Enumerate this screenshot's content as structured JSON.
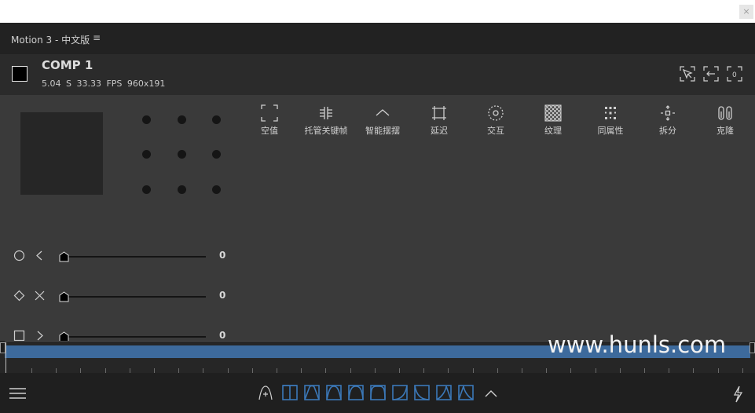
{
  "window": {
    "close_glyph": "×"
  },
  "titlebar": {
    "title": "Motion 3 - 中文版",
    "menu_icon": "≡"
  },
  "comp": {
    "name": "COMP 1",
    "duration": "5.04 S",
    "fps": "33.33 FPS",
    "size": "960x191",
    "swatch_color": "#000000"
  },
  "header_buttons": [
    "select-cursor-icon",
    "fit-left-icon",
    "fit-zero-icon"
  ],
  "header_button_text": "0",
  "tools": [
    {
      "icon": "null-icon",
      "label": "空值"
    },
    {
      "icon": "keyframe-manage-icon",
      "label": "托管关键帧"
    },
    {
      "icon": "smart-swing-icon",
      "label": "智能摆摆"
    },
    {
      "icon": "delay-icon",
      "label": "延迟"
    },
    {
      "icon": "interact-icon",
      "label": "交互"
    },
    {
      "icon": "texture-icon",
      "label": "纹理"
    },
    {
      "icon": "same-attr-icon",
      "label": "同属性"
    },
    {
      "icon": "split-icon",
      "label": "拆分"
    },
    {
      "icon": "clone-icon",
      "label": "克隆"
    }
  ],
  "anchor_grid": {
    "rows": 3,
    "cols": 3
  },
  "sliders": [
    {
      "shape_icon": "circle-icon",
      "arrow_icon": "chevron-left-icon",
      "value": "0"
    },
    {
      "shape_icon": "diamond-icon",
      "arrow_icon": "x-icon",
      "value": "0"
    },
    {
      "shape_icon": "square-icon",
      "arrow_icon": "chevron-right-icon",
      "value": "0"
    }
  ],
  "easing_presets": [
    "linear-ease",
    "ease-in-out-a",
    "ease-in-out-b",
    "ease-in-out-c",
    "ease-flat",
    "ease-in",
    "ease-out",
    "ease-sharp-a",
    "ease-sharp-b"
  ],
  "bottom": {
    "menu_icon": "hamburger-icon",
    "bolt_icon": "bolt-icon",
    "collapse_icon": "chevron-up-icon"
  },
  "watermark": "www.hunls.com",
  "colors": {
    "accent": "#3b78b8",
    "timeline_bar": "#3d6a9c",
    "panel": "#3a3a3a"
  }
}
